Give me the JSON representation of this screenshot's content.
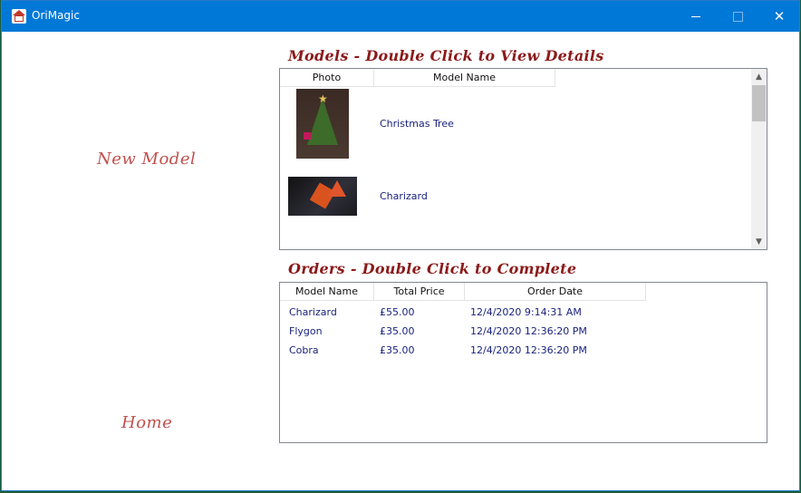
{
  "window": {
    "title": "OriMagic",
    "minimize_label": "",
    "maximize_label": "",
    "close_label": "✕"
  },
  "nav": {
    "new_model": "New Model",
    "home": "Home"
  },
  "models": {
    "title": "Models - Double Click to View Details",
    "columns": [
      "Photo",
      "Model Name"
    ],
    "rows": [
      {
        "photo": "christmas-tree-photo",
        "name": "Christmas Tree"
      },
      {
        "photo": "charizard-photo",
        "name": "Charizard"
      }
    ]
  },
  "orders": {
    "title": "Orders - Double Click to Complete",
    "columns": [
      "Model Name",
      "Total Price",
      "Order Date"
    ],
    "rows": [
      {
        "model": "Charizard",
        "price": "£55.00",
        "date": "12/4/2020 9:14:31 AM"
      },
      {
        "model": "Flygon",
        "price": "£35.00",
        "date": "12/4/2020 12:36:20 PM"
      },
      {
        "model": "Cobra",
        "price": "£35.00",
        "date": "12/4/2020 12:36:20 PM"
      }
    ]
  }
}
